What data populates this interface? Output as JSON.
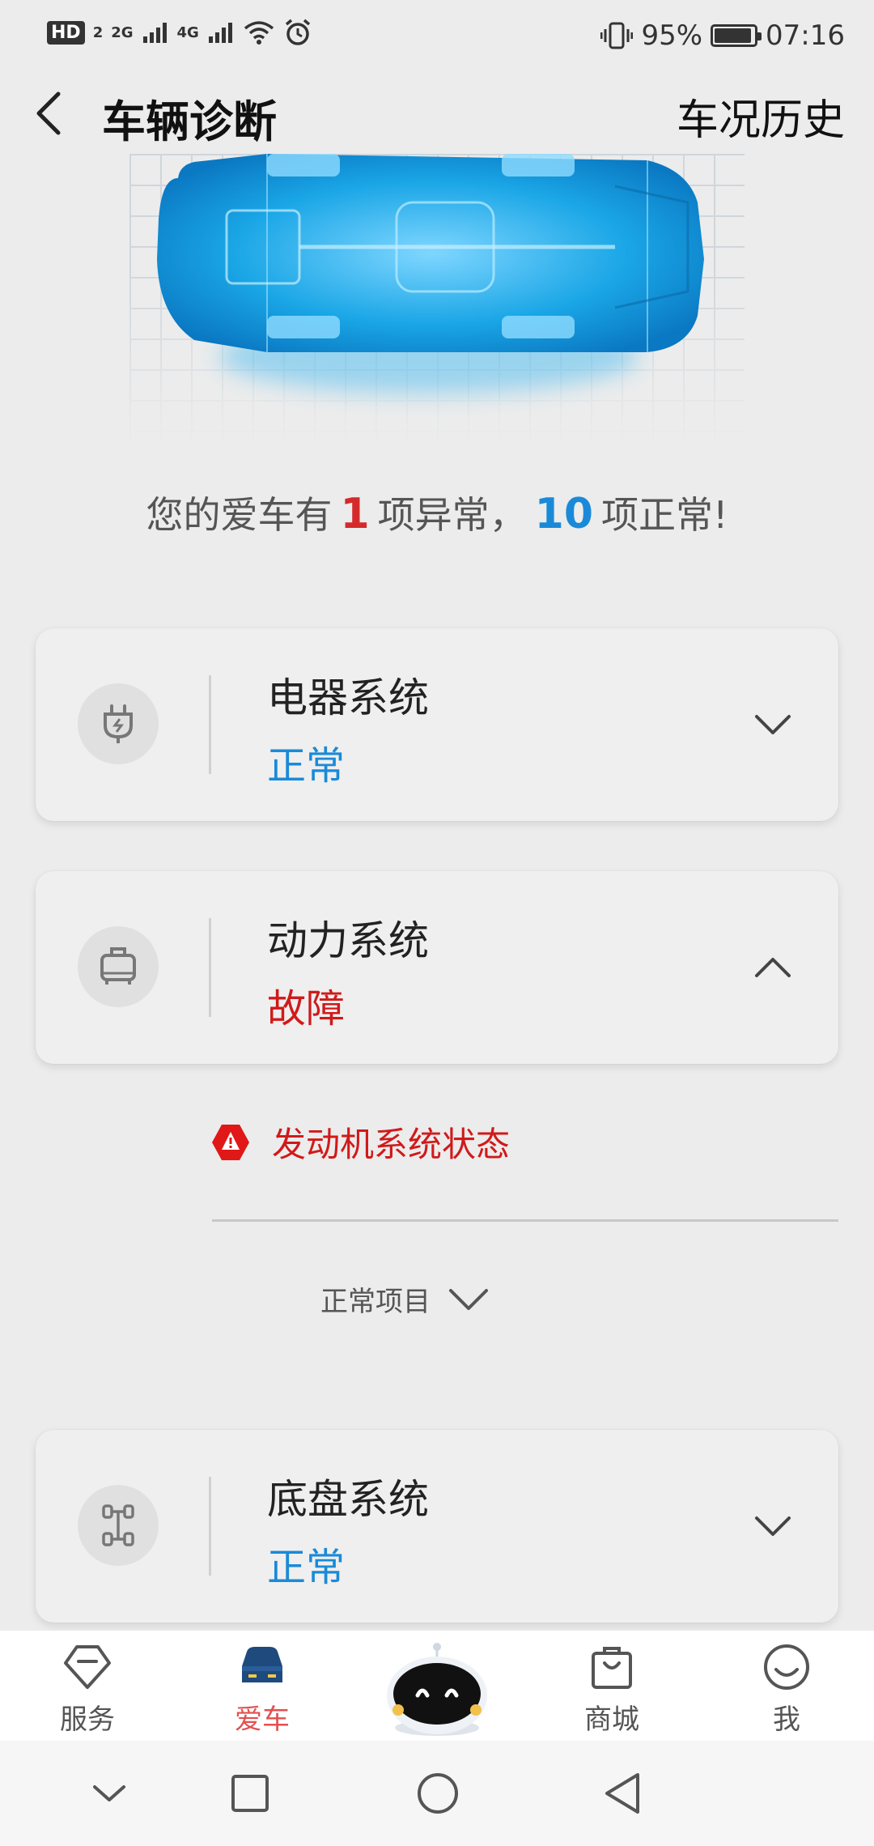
{
  "status_bar": {
    "left_badge": "HD",
    "left_badge_sub": "2",
    "net1": "2G",
    "net2": "4G",
    "battery": "95%",
    "battery_level": 0.95,
    "time": "07:16"
  },
  "header": {
    "title": "车辆诊断",
    "right_link": "车况历史"
  },
  "summary": {
    "prefix": "您的爱车有",
    "abnormal_count": "1",
    "middle": "项异常，",
    "normal_count": "10",
    "suffix": "项正常!"
  },
  "systems": [
    {
      "title": "电器系统",
      "status": "正常",
      "icon": "plug-icon",
      "expanded": false
    },
    {
      "title": "动力系统",
      "status": "故障",
      "icon": "engine-icon",
      "expanded": true
    },
    {
      "title": "底盘系统",
      "status": "正常",
      "icon": "chassis-icon",
      "expanded": false
    }
  ],
  "fault_detail": {
    "label": "发动机系统状态",
    "icon": "warning-icon"
  },
  "normal_items_toggle": "正常项目",
  "colors": {
    "ok": "#1a8ad8",
    "fault": "#d01a1a",
    "active_tab": "#e25050",
    "car_blue": "#18a8e8"
  },
  "tabs": [
    {
      "label": "服务",
      "icon": "service-icon",
      "active": false
    },
    {
      "label": "爱车",
      "icon": "car-icon",
      "active": true
    },
    {
      "label": "",
      "icon": "robot-assistant-icon",
      "active": false
    },
    {
      "label": "商城",
      "icon": "shopping-bag-icon",
      "active": false
    },
    {
      "label": "我",
      "icon": "smile-icon",
      "active": false
    }
  ],
  "system_nav": [
    "collapse-icon",
    "recents-icon",
    "home-icon",
    "back-icon"
  ]
}
